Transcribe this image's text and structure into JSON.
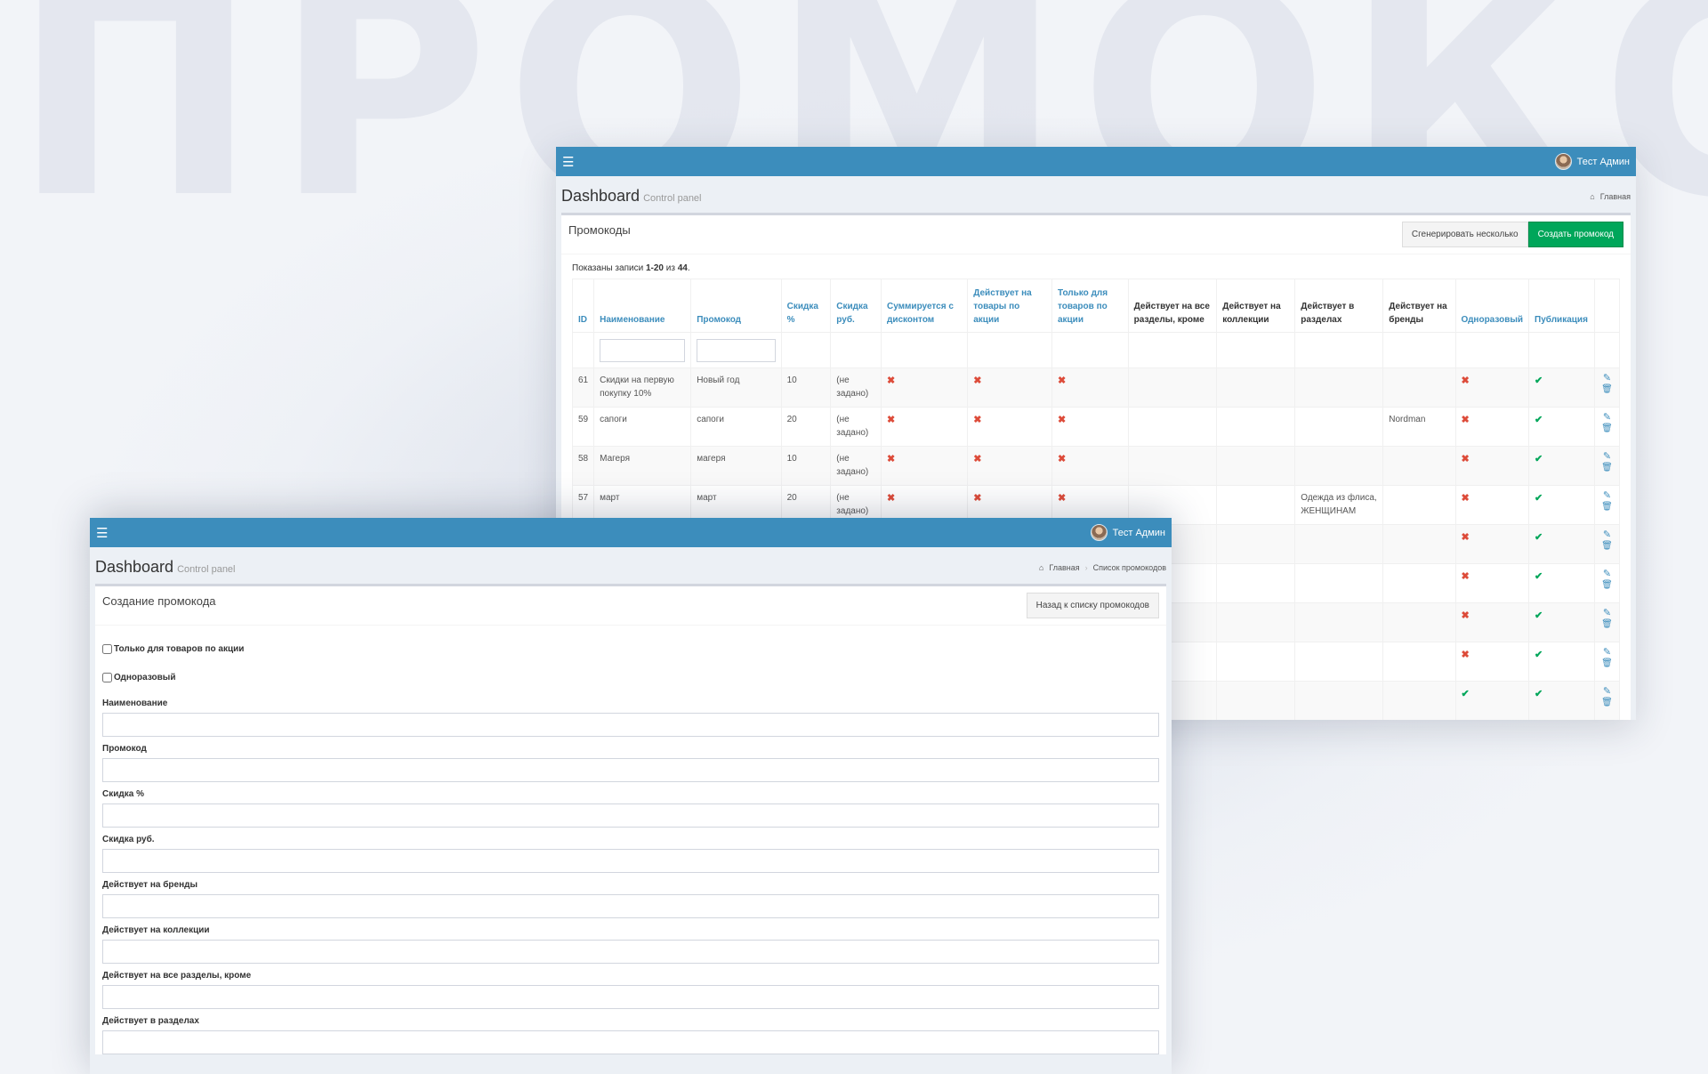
{
  "background_word": "ПРОМОКОД",
  "colors": {
    "primary": "#3c8dbc",
    "success": "#00a65a",
    "danger": "#dd4b39"
  },
  "list_window": {
    "user": "Тест Админ",
    "title": "Dashboard",
    "subtitle": "Control panel",
    "breadcrumb": [
      "Главная"
    ],
    "box_title": "Промокоды",
    "generate_button": "Сгенерировать несколько",
    "create_button": "Создать промокод",
    "summary": {
      "prefix": "Показаны записи ",
      "range": "1-20",
      "middle": " из ",
      "total": "44",
      "suffix": "."
    },
    "columns": [
      "ID",
      "Наименование",
      "Промокод",
      "Скидка %",
      "Скидка руб.",
      "Суммируется с дисконтом",
      "Действует на товары по акции",
      "Только для товаров по акции",
      "Действует на все разделы, кроме",
      "Действует на коллекции",
      "Действует в разделах",
      "Действует на бренды",
      "Одноразовый",
      "Публикация"
    ],
    "rows": [
      {
        "id": "61",
        "name": "Скидки на первую покупку 10%",
        "code": "Новый год",
        "pct": "10",
        "rub": "(не задано)",
        "sum": "no",
        "promo": "no",
        "only": "no",
        "except": "",
        "coll": "",
        "sections": "",
        "brands": "",
        "once": "no",
        "pub": "yes"
      },
      {
        "id": "59",
        "name": "сапоги",
        "code": "сапоги",
        "pct": "20",
        "rub": "(не задано)",
        "sum": "no",
        "promo": "no",
        "only": "no",
        "except": "",
        "coll": "",
        "sections": "",
        "brands": "Nordman",
        "once": "no",
        "pub": "yes"
      },
      {
        "id": "58",
        "name": "Магеря",
        "code": "магеря",
        "pct": "10",
        "rub": "(не задано)",
        "sum": "no",
        "promo": "no",
        "only": "no",
        "except": "",
        "coll": "",
        "sections": "",
        "brands": "",
        "once": "no",
        "pub": "yes"
      },
      {
        "id": "57",
        "name": "март",
        "code": "март",
        "pct": "20",
        "rub": "(не задано)",
        "sum": "no",
        "promo": "no",
        "only": "no",
        "except": "",
        "coll": "",
        "sections": "Одежда из флиса, ЖЕНЩИНАМ",
        "brands": "",
        "once": "no",
        "pub": "yes"
      },
      {
        "id": "",
        "name": "",
        "code": "",
        "pct": "",
        "rub": "",
        "sum": "",
        "promo": "",
        "only": "",
        "except": "",
        "coll": "",
        "sections": "",
        "brands": "",
        "once": "no",
        "pub": "yes"
      },
      {
        "id": "",
        "name": "",
        "code": "",
        "pct": "",
        "rub": "",
        "sum": "",
        "promo": "",
        "only": "",
        "except": "",
        "coll": "",
        "sections": "",
        "brands": "",
        "once": "no",
        "pub": "yes"
      },
      {
        "id": "",
        "name": "",
        "code": "",
        "pct": "",
        "rub": "",
        "sum": "",
        "promo": "",
        "only": "",
        "except": "",
        "coll": "",
        "sections": "",
        "brands": "",
        "once": "no",
        "pub": "yes"
      },
      {
        "id": "",
        "name": "",
        "code": "",
        "pct": "",
        "rub": "",
        "sum": "",
        "promo": "",
        "only": "",
        "except": "",
        "coll": "",
        "sections": "",
        "brands": "",
        "once": "no",
        "pub": "yes"
      },
      {
        "id": "",
        "name": "",
        "code": "",
        "pct": "",
        "rub": "",
        "sum": "",
        "promo": "",
        "only": "",
        "except": "",
        "coll": "",
        "sections": "",
        "brands": "",
        "once": "yes",
        "pub": "yes"
      }
    ]
  },
  "form_window": {
    "user": "Тест Админ",
    "title": "Dashboard",
    "subtitle": "Control panel",
    "breadcrumb": [
      "Главная",
      "Список промокодов"
    ],
    "box_title": "Создание промокода",
    "back_button": "Назад к списку промокодов",
    "checkboxes": [
      "Только для товаров по акции",
      "Одноразовый"
    ],
    "fields": [
      "Наименование",
      "Промокод",
      "Скидка %",
      "Скидка руб.",
      "Действует на бренды",
      "Действует на коллекции",
      "Действует на все разделы, кроме",
      "Действует в разделах"
    ]
  }
}
